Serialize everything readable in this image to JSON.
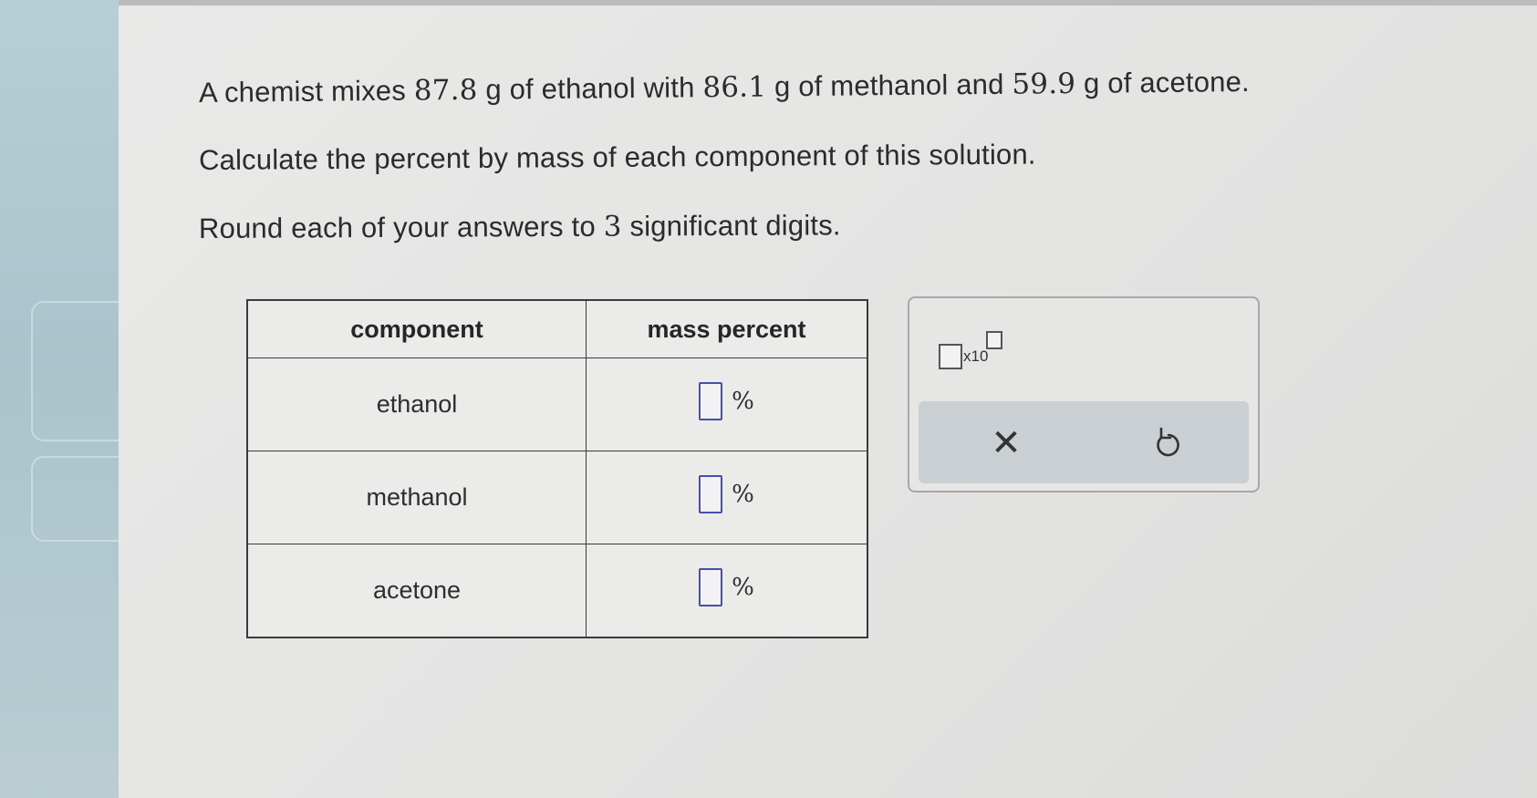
{
  "question": {
    "line1": {
      "a": "A chemist mixes ",
      "ethanol_mass": "87.8",
      "b": " g of ethanol with ",
      "methanol_mass": "86.1",
      "c": " g of methanol and ",
      "acetone_mass": "59.9",
      "d": " g of acetone."
    },
    "line2": "Calculate the percent by mass of each component of this solution.",
    "line3": {
      "a": "Round each of your answers to ",
      "digits": "3",
      "b": " significant digits."
    }
  },
  "table": {
    "headers": [
      "component",
      "mass percent"
    ],
    "rows": [
      {
        "component": "ethanol",
        "value": "",
        "unit": "%"
      },
      {
        "component": "methanol",
        "value": "",
        "unit": "%"
      },
      {
        "component": "acetone",
        "value": "",
        "unit": "%"
      }
    ]
  },
  "tools": {
    "sci_notation_label": "x10",
    "clear_icon": "close-icon",
    "undo_icon": "undo-icon"
  },
  "colors": {
    "input_border": "#4a4ea8",
    "toolbar_bg": "#c9cfd2"
  }
}
